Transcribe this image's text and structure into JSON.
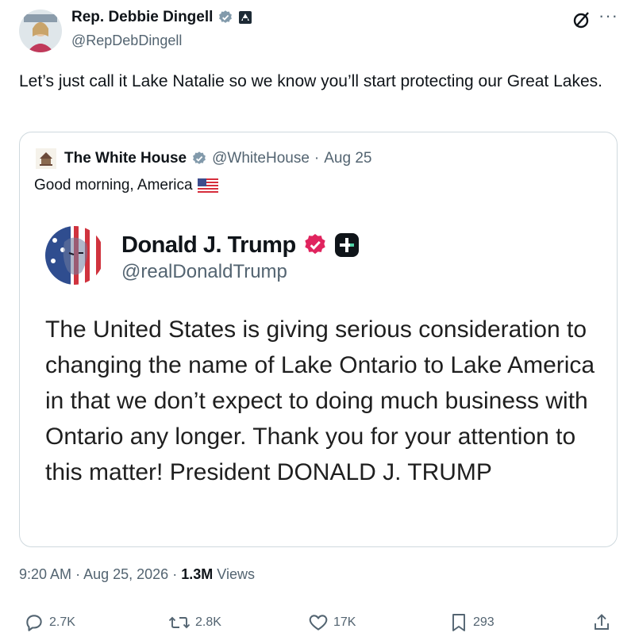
{
  "author": {
    "name": "Rep. Debbie Dingell",
    "handle": "@RepDebDingell"
  },
  "tweet": {
    "text": "Let’s just call it Lake Natalie so we know you’ll start protecting our Great Lakes."
  },
  "quoted": {
    "name": "The White House",
    "handle": "@WhiteHouse",
    "sep": "·",
    "date": "Aug 25",
    "text": "Good morning, America",
    "embedded": {
      "name": "Donald J. Trump",
      "handle": "@realDonaldTrump",
      "text": "The United States is giving serious consideration to changing the name of Lake Ontario to Lake America in that we don’t expect to doing much business with Ontario any longer. Thank you for your attention to this matter! President DONALD J. TRUMP"
    }
  },
  "meta": {
    "time": "9:20 AM",
    "sep1": "·",
    "date": "Aug 25, 2026",
    "sep2": "·",
    "views_count": "1.3M",
    "views_label": "Views"
  },
  "actions": {
    "replies": "2.7K",
    "reposts": "2.8K",
    "likes": "17K",
    "bookmarks": "293"
  },
  "icons": {
    "verified": "verified-badge-icon",
    "govt": "government-label-icon",
    "grok": "grok-icon",
    "more": "more-icon",
    "reply": "reply-icon",
    "repost": "repost-icon",
    "like": "heart-icon",
    "bookmark": "bookmark-icon",
    "share": "share-icon"
  },
  "colors": {
    "verified_gray": "#829aab",
    "truth_verified": "#e0245e",
    "secondary": "#536471",
    "border": "#cfd9de"
  }
}
